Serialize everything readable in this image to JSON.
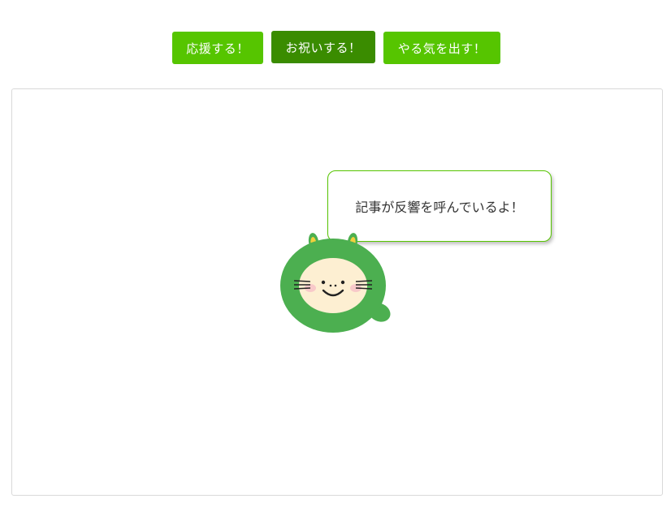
{
  "buttons": {
    "cheer": "応援する！",
    "celebrate": "お祝いする！",
    "motivate": "やる気を出す！"
  },
  "bubble": {
    "message": "記事が反響を呼んでいるよ！"
  },
  "colors": {
    "button_green": "#56c500",
    "button_active": "#3a8c00",
    "mascot_green": "#4caf50",
    "ear_yellow": "#f2d03c",
    "face_cream": "#fdefd2",
    "cheek_pink": "#f8c9c9"
  },
  "mascot": {
    "icon": "green-mascot-icon"
  }
}
